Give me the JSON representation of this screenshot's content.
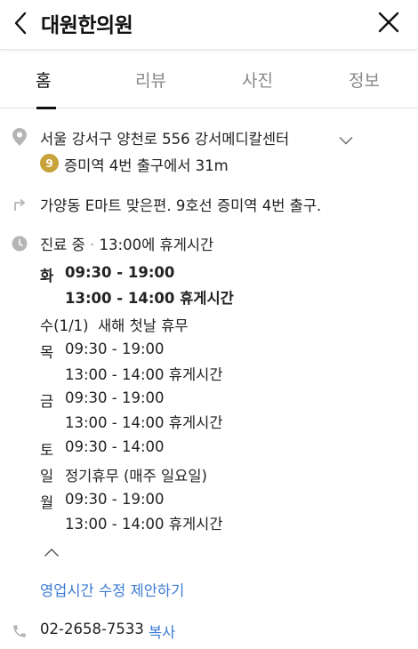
{
  "header": {
    "title": "대원한의원"
  },
  "tabs": [
    "홈",
    "리뷰",
    "사진",
    "정보"
  ],
  "address": {
    "text": "서울 강서구 양천로 556 강서메디칼센터",
    "subway_line": "9",
    "subway_text": "증미역 4번 출구에서 31m",
    "directions": "가양동 E마트 맞은편. 9호선 증미역 4번 출구."
  },
  "hours": {
    "status": "진료 중",
    "separator": "·",
    "status_note": "13:00에 휴게시간",
    "days": [
      {
        "day": "화",
        "lines": [
          "09:30 - 19:00",
          "13:00 - 14:00 휴게시간"
        ]
      },
      {
        "day": "수(1/1)",
        "lines": [
          "새해 첫날 휴무"
        ]
      },
      {
        "day": "목",
        "lines": [
          "09:30 - 19:00",
          "13:00 - 14:00 휴게시간"
        ]
      },
      {
        "day": "금",
        "lines": [
          "09:30 - 19:00",
          "13:00 - 14:00 휴게시간"
        ]
      },
      {
        "day": "토",
        "lines": [
          "09:30 - 14:00"
        ]
      },
      {
        "day": "일",
        "lines": [
          "정기휴무 (매주 일요일)"
        ]
      },
      {
        "day": "월",
        "lines": [
          "09:30 - 19:00",
          "13:00 - 14:00 휴게시간"
        ]
      }
    ],
    "suggest_link": "영업시간 수정 제안하기"
  },
  "contact": {
    "phone": "02-2658-7533",
    "copy_label": "복사"
  },
  "colors": {
    "link": "#3b7bd4",
    "subway_line_9": "#c8a23b",
    "icon_grey": "#b5b5b5"
  }
}
